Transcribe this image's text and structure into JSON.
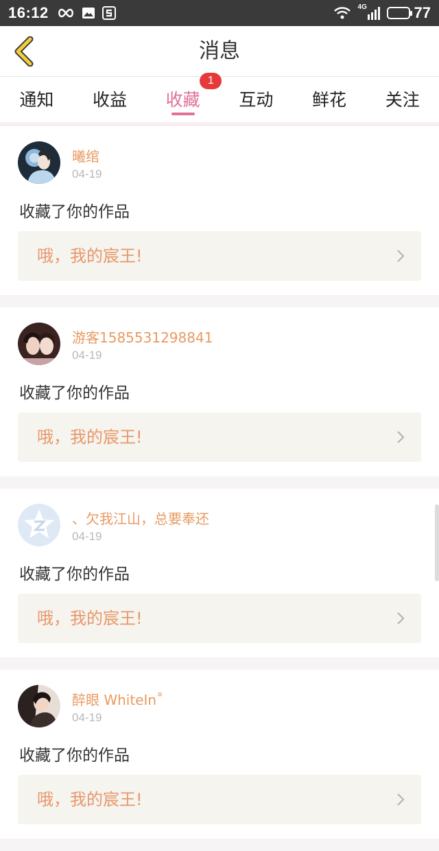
{
  "status_bar": {
    "time": "16:12",
    "network": "4G",
    "battery": "77",
    "battery_level": 0.77
  },
  "header": {
    "title": "消息"
  },
  "tabs": [
    {
      "label": "通知"
    },
    {
      "label": "收益"
    },
    {
      "label": "收藏",
      "badge": "1",
      "active": true
    },
    {
      "label": "互动"
    },
    {
      "label": "鲜花"
    },
    {
      "label": "关注"
    }
  ],
  "feed": [
    {
      "user": "曦绾",
      "date": "04-19",
      "action": "收藏了你的作品",
      "work": "哦，我的宸王!"
    },
    {
      "user": "游客1585531298841",
      "date": "04-19",
      "action": "收藏了你的作品",
      "work": "哦，我的宸王!"
    },
    {
      "user": "、欠我江山，总要奉还",
      "date": "04-19",
      "action": "收藏了你的作品",
      "work": "哦，我的宸王!"
    },
    {
      "user": "醉眼 WhiteIn˚",
      "date": "04-19",
      "action": "收藏了你的作品",
      "work": "哦，我的宸王!"
    }
  ],
  "colors": {
    "accent_pink": "#e0709a",
    "name_orange": "#e89a62",
    "badge_red": "#e63a3a",
    "back_arrow": "#f2cf3a"
  }
}
